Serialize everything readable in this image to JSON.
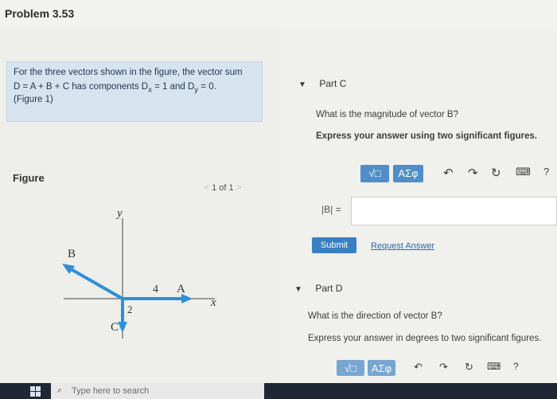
{
  "header": {
    "title": "Problem 3.53"
  },
  "prompt": {
    "line1": "For the three vectors shown in the figure, the vector sum",
    "line2_a": "D = A + B + C has components D",
    "line2_b": "= 1 and D",
    "line2_c": "= 0.",
    "sub_x": "x",
    "sub_y": "y",
    "figure_link": "(Figure 1)"
  },
  "figure": {
    "label": "Figure",
    "pager": "1 of 1",
    "axis_y": "y",
    "axis_x": "x",
    "vec_b": "B",
    "vec_a": "A",
    "vec_c": "C",
    "len_a": "4",
    "len_c": "2"
  },
  "partC": {
    "label": "Part C",
    "question": "What is the magnitude of vector B?",
    "instruction": "Express your answer using two significant figures.",
    "answer_label": "|B| =",
    "answer_value": "",
    "submit": "Submit",
    "request": "Request Answer",
    "tool_math": "√□",
    "tool_greek": "ΑΣφ",
    "tool_help": "?"
  },
  "partD": {
    "label": "Part D",
    "question": "What is the direction of vector B?",
    "instruction": "Express your answer in degrees to two significant figures.",
    "tool_math": "√□",
    "tool_greek": "ΑΣφ",
    "tool_help": "?"
  },
  "taskbar": {
    "search_placeholder": "Type here to search"
  },
  "colors": {
    "vector": "#2f8fd8",
    "panel": "#d6e4ef",
    "submit": "#3a7fc1"
  }
}
